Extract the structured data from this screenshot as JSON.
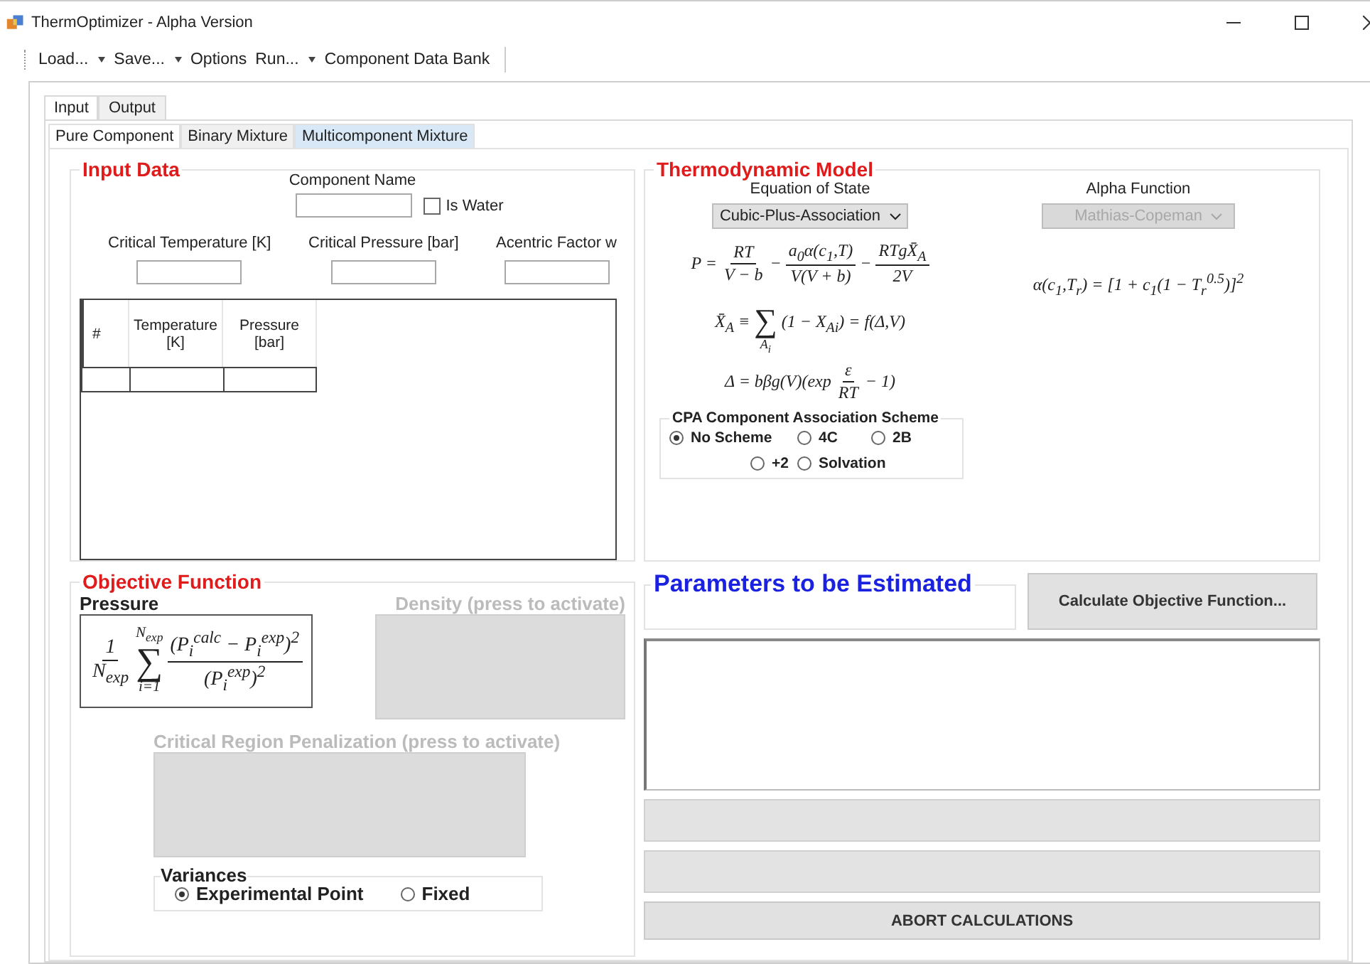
{
  "window": {
    "title": "ThermOptimizer - Alpha Version"
  },
  "toolbar": [
    {
      "label": "Load...",
      "dropdown": true
    },
    {
      "label": "Save...",
      "dropdown": true
    },
    {
      "label": "Options",
      "dropdown": false
    },
    {
      "label": "Run...",
      "dropdown": true
    },
    {
      "label": "Component Data Bank",
      "dropdown": false
    }
  ],
  "tabs": [
    {
      "label": "Input",
      "selected": true
    },
    {
      "label": "Output",
      "selected": false
    }
  ],
  "subtabs": [
    {
      "label": "Pure Component",
      "selected": true,
      "hovered": false
    },
    {
      "label": "Binary Mixture",
      "selected": false,
      "hovered": false
    },
    {
      "label": "Multicomponent Mixture",
      "selected": false,
      "hovered": true
    }
  ],
  "input_data": {
    "title": "Input Data",
    "component_name": {
      "label": "Component Name"
    },
    "is_water": {
      "label": "Is Water",
      "checked": false
    },
    "fields": [
      {
        "label": "Critical Temperature [K]"
      },
      {
        "label": "Critical Pressure [bar]"
      },
      {
        "label": "Acentric Factor w"
      }
    ],
    "table": {
      "columns": [
        "#",
        "Temperature [K]",
        "Pressure [bar]"
      ]
    }
  },
  "thermodynamic_model": {
    "title": "Thermodynamic Model",
    "eos": {
      "label": "Equation of State",
      "value": "Cubic-Plus-Association",
      "disabled": false
    },
    "alpha": {
      "label": "Alpha Function",
      "value": "Mathias-Copeman",
      "disabled": true
    },
    "eos_formulas": [
      [
        {
          "kind": "text",
          "text": "P ="
        },
        {
          "kind": "frac",
          "num": "RT",
          "den": "V − b"
        },
        {
          "kind": "text",
          "text": "−"
        },
        {
          "kind": "frac",
          "num": "a$_{0}$α(c$_{1}$,T)",
          "den": "V(V + b)"
        },
        {
          "kind": "text",
          "text": "−"
        },
        {
          "kind": "frac",
          "num": "RTgX̄$_{A}$",
          "den": "2V"
        }
      ],
      [
        {
          "kind": "text",
          "text": "X̄$_{A}$ ≡"
        },
        {
          "kind": "sum",
          "symbol": "∑",
          "bottom": "A$_{i}$"
        },
        {
          "kind": "text",
          "text": "(1 − X$_{Ai}$) = f(Δ,V)"
        }
      ],
      [
        {
          "kind": "text",
          "text": "Δ = bβg(V)(exp"
        },
        {
          "kind": "frac",
          "num": "ε",
          "den": "RT"
        },
        {
          "kind": "text",
          "text": "− 1)"
        }
      ]
    ],
    "alpha_formula": [
      {
        "kind": "text",
        "text": "α(c$_{1}$,T$_{r}$) = [1 + c$_{1}$(1 − T$_{r}$$^{0.5}$)]$^{2}$"
      }
    ],
    "scheme": {
      "title": "CPA Component Association Scheme",
      "options": [
        {
          "label": "No Scheme",
          "selected": true
        },
        {
          "label": "4C",
          "selected": false
        },
        {
          "label": "2B",
          "selected": false
        },
        {
          "label": "+2",
          "selected": false
        },
        {
          "label": "Solvation",
          "selected": false
        }
      ]
    }
  },
  "objective_function": {
    "title": "Objective Function",
    "pressure": {
      "label": "Pressure",
      "formula": [
        {
          "kind": "frac",
          "num": "1",
          "den": "N$_{exp}$"
        },
        {
          "kind": "sum",
          "symbol": "∑",
          "top": "N$_{exp}$",
          "bottom": "i=1"
        },
        {
          "kind": "frac",
          "num": "(P$_{i}$$^{calc}$ − P$_{i}$$^{exp}$)$^{2}$",
          "den": "(P$_{i}$$^{exp}$)$^{2}$"
        }
      ]
    },
    "density": {
      "label": "Density (press to activate)",
      "disabled": true
    },
    "penalization": {
      "label": "Critical Region Penalization (press to activate)",
      "disabled": true
    },
    "variances": {
      "title": "Variances",
      "options": [
        {
          "label": "Experimental Point",
          "selected": true
        },
        {
          "label": "Fixed",
          "selected": false
        }
      ]
    }
  },
  "parameters": {
    "title": "Parameters to be Estimated",
    "progress": [
      {
        "level": 0
      },
      {
        "level": 0
      }
    ],
    "calculate_button": "Calculate Objective Function...",
    "abort_button": "ABORT CALCULATIONS"
  }
}
